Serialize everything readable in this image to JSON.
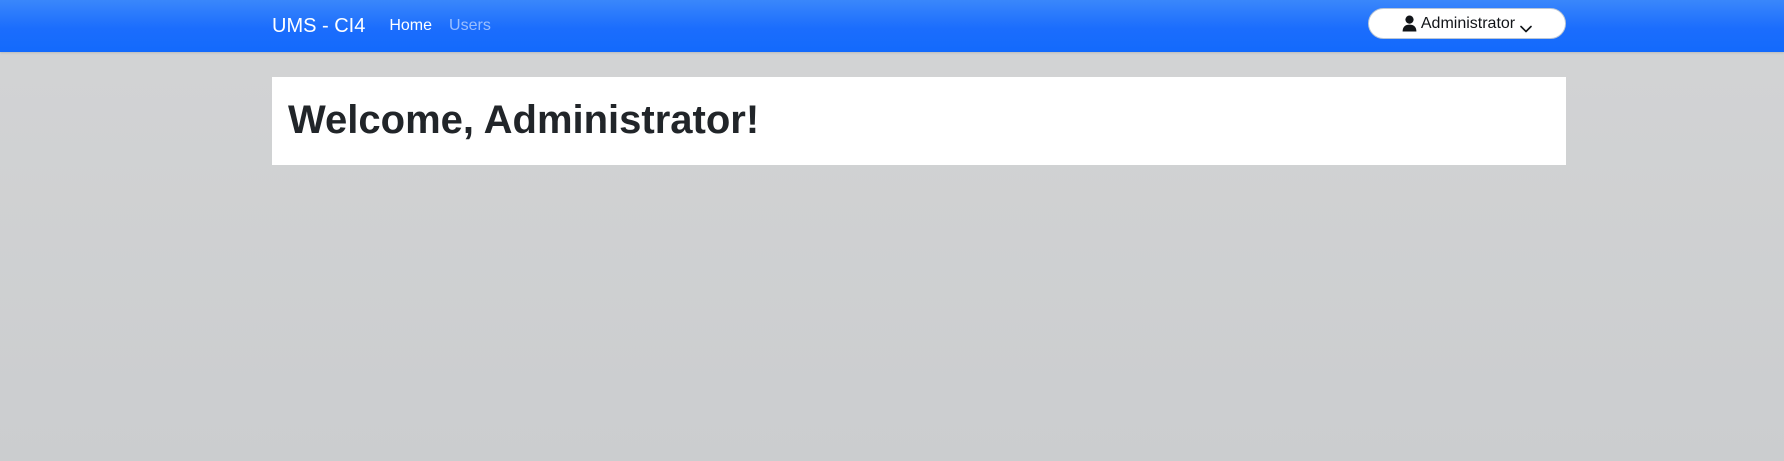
{
  "navbar": {
    "brand": "UMS - CI4",
    "links": [
      {
        "label": "Home",
        "active": true
      },
      {
        "label": "Users",
        "active": false
      }
    ],
    "user_menu": {
      "label": "Administrator",
      "icon": "user-icon",
      "dropdown_icon": "chevron-down-icon"
    },
    "color": "#1b6dfd"
  },
  "main": {
    "heading": "Welcome, Administrator!"
  },
  "colors": {
    "background": "#cdced0",
    "card": "#ffffff",
    "heading_text": "#212529"
  }
}
